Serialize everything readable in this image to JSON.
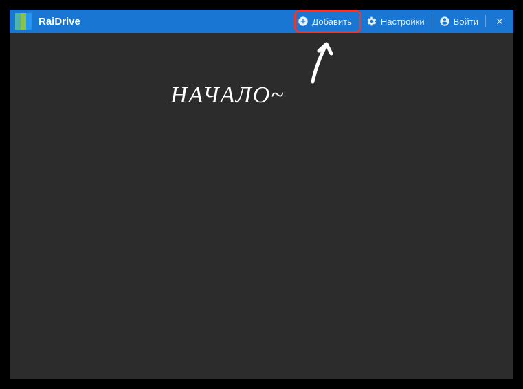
{
  "app": {
    "name": "RaiDrive"
  },
  "toolbar": {
    "add_label": "Добавить",
    "settings_label": "Настройки",
    "login_label": "Войти"
  },
  "annotation": {
    "text": "НАЧАЛО~"
  }
}
